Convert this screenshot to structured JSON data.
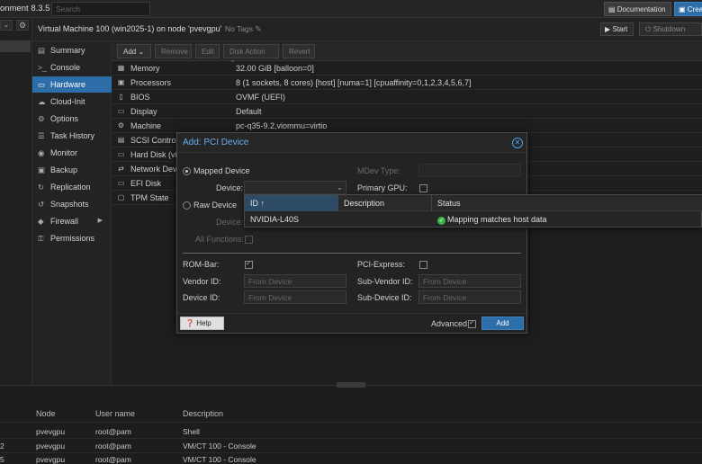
{
  "topbar": {
    "brand": "onment 8.3.5",
    "search_placeholder": "Search",
    "documentation_label": "Documentation",
    "create_label": "Crea"
  },
  "vm": {
    "title": "Virtual Machine 100 (win2025-1) on node 'pvevgpu'",
    "tags": "No Tags",
    "start_label": "Start",
    "shutdown_label": "Shutdown"
  },
  "nav": {
    "items": [
      {
        "icon": "summary-icon",
        "glyph": "▤",
        "label": "Summary"
      },
      {
        "icon": "console-icon",
        "glyph": ">_",
        "label": "Console"
      },
      {
        "icon": "hardware-icon",
        "glyph": "▭",
        "label": "Hardware",
        "active": true
      },
      {
        "icon": "cloud-icon",
        "glyph": "☁",
        "label": "Cloud-Init"
      },
      {
        "icon": "gear-icon",
        "glyph": "⚙",
        "label": "Options"
      },
      {
        "icon": "task-history-icon",
        "glyph": "☰",
        "label": "Task History"
      },
      {
        "icon": "monitor-icon",
        "glyph": "◉",
        "label": "Monitor"
      },
      {
        "icon": "backup-icon",
        "glyph": "▣",
        "label": "Backup"
      },
      {
        "icon": "replication-icon",
        "glyph": "↻",
        "label": "Replication"
      },
      {
        "icon": "snapshots-icon",
        "glyph": "↺",
        "label": "Snapshots"
      },
      {
        "icon": "firewall-icon",
        "glyph": "◆",
        "label": "Firewall",
        "caret": true
      },
      {
        "icon": "permissions-icon",
        "glyph": "⚿",
        "label": "Permissions"
      }
    ]
  },
  "toolbar": {
    "add_label": "Add",
    "remove_label": "Remove",
    "edit_label": "Edit",
    "disk_action_label": "Disk Action",
    "revert_label": "Revert"
  },
  "hardware": [
    {
      "icon": "memory-icon",
      "glyph": "▦",
      "name": "Memory",
      "value": "32.00 GiB [balloon=0]"
    },
    {
      "icon": "processor-icon",
      "glyph": "▣",
      "name": "Processors",
      "value": "8 (1 sockets, 8 cores) [host] [numa=1] [cpuaffinity=0,1,2,3,4,5,6,7]"
    },
    {
      "icon": "bios-icon",
      "glyph": "▯",
      "name": "BIOS",
      "value": "OVMF (UEFI)"
    },
    {
      "icon": "display-icon",
      "glyph": "▭",
      "name": "Display",
      "value": "Default"
    },
    {
      "icon": "machine-icon",
      "glyph": "⚙",
      "name": "Machine",
      "value": "pc-q35-9.2,viommu=virtio"
    },
    {
      "icon": "scsi-icon",
      "glyph": "▤",
      "name": "SCSI Controller",
      "value": ""
    },
    {
      "icon": "hard-disk-icon",
      "glyph": "▭",
      "name": "Hard Disk (virtio0)",
      "value": ""
    },
    {
      "icon": "network-icon",
      "glyph": "⇄",
      "name": "Network Device (net0)",
      "value": ""
    },
    {
      "icon": "efi-disk-icon",
      "glyph": "▭",
      "name": "EFI Disk",
      "value": ""
    },
    {
      "icon": "tpm-icon",
      "glyph": "▢",
      "name": "TPM State",
      "value": ""
    }
  ],
  "dialog": {
    "title": "Add: PCI Device",
    "mapped_device_label": "Mapped Device",
    "device_label": "Device:",
    "raw_device_label": "Raw Device",
    "raw_device_field_label": "Device:",
    "all_functions_label": "All Functions:",
    "mdev_type_label": "MDev Type:",
    "primary_gpu_label": "Primary GPU:",
    "rom_bar_label": "ROM-Bar:",
    "pci_express_label": "PCI-Express:",
    "vendor_id_label": "Vendor ID:",
    "vendor_id_placeholder": "From Device",
    "sub_vendor_id_label": "Sub-Vendor ID:",
    "sub_vendor_id_placeholder": "From Device",
    "device_id_label": "Device ID:",
    "device_id_placeholder": "From Device",
    "sub_device_id_label": "Sub-Device ID:",
    "sub_device_id_placeholder": "From Device",
    "help_label": "Help",
    "advanced_label": "Advanced",
    "add_label": "Add"
  },
  "device_dropdown": {
    "columns": [
      "ID ↑",
      "Description",
      "Status"
    ],
    "rows": [
      {
        "id": "NVIDIA-L40S",
        "description": "",
        "status": "Mapping matches host data"
      }
    ]
  },
  "tasks": {
    "columns": [
      "Node",
      "User name",
      "Description"
    ],
    "rows": [
      {
        "left": "",
        "node": "pvevgpu",
        "user": "root@pam",
        "description": "Shell"
      },
      {
        "left": "2",
        "node": "pvevgpu",
        "user": "root@pam",
        "description": "VM/CT 100 - Console"
      },
      {
        "left": "5",
        "node": "pvevgpu",
        "user": "root@pam",
        "description": "VM/CT 100 - Console"
      }
    ]
  },
  "colors": {
    "accent": "#2d6ea8",
    "dialog_title": "#6aaef0",
    "status_ok": "#3bb54a"
  }
}
